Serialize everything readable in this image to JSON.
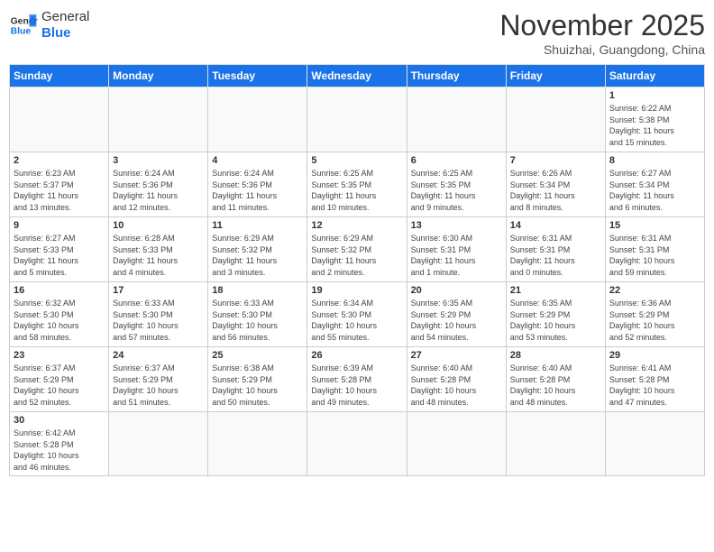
{
  "logo": {
    "line1": "General",
    "line2": "Blue"
  },
  "title": "November 2025",
  "location": "Shuizhai, Guangdong, China",
  "days_of_week": [
    "Sunday",
    "Monday",
    "Tuesday",
    "Wednesday",
    "Thursday",
    "Friday",
    "Saturday"
  ],
  "weeks": [
    [
      {
        "day": "",
        "info": ""
      },
      {
        "day": "",
        "info": ""
      },
      {
        "day": "",
        "info": ""
      },
      {
        "day": "",
        "info": ""
      },
      {
        "day": "",
        "info": ""
      },
      {
        "day": "",
        "info": ""
      },
      {
        "day": "1",
        "info": "Sunrise: 6:22 AM\nSunset: 5:38 PM\nDaylight: 11 hours\nand 15 minutes."
      }
    ],
    [
      {
        "day": "2",
        "info": "Sunrise: 6:23 AM\nSunset: 5:37 PM\nDaylight: 11 hours\nand 13 minutes."
      },
      {
        "day": "3",
        "info": "Sunrise: 6:24 AM\nSunset: 5:36 PM\nDaylight: 11 hours\nand 12 minutes."
      },
      {
        "day": "4",
        "info": "Sunrise: 6:24 AM\nSunset: 5:36 PM\nDaylight: 11 hours\nand 11 minutes."
      },
      {
        "day": "5",
        "info": "Sunrise: 6:25 AM\nSunset: 5:35 PM\nDaylight: 11 hours\nand 10 minutes."
      },
      {
        "day": "6",
        "info": "Sunrise: 6:25 AM\nSunset: 5:35 PM\nDaylight: 11 hours\nand 9 minutes."
      },
      {
        "day": "7",
        "info": "Sunrise: 6:26 AM\nSunset: 5:34 PM\nDaylight: 11 hours\nand 8 minutes."
      },
      {
        "day": "8",
        "info": "Sunrise: 6:27 AM\nSunset: 5:34 PM\nDaylight: 11 hours\nand 6 minutes."
      }
    ],
    [
      {
        "day": "9",
        "info": "Sunrise: 6:27 AM\nSunset: 5:33 PM\nDaylight: 11 hours\nand 5 minutes."
      },
      {
        "day": "10",
        "info": "Sunrise: 6:28 AM\nSunset: 5:33 PM\nDaylight: 11 hours\nand 4 minutes."
      },
      {
        "day": "11",
        "info": "Sunrise: 6:29 AM\nSunset: 5:32 PM\nDaylight: 11 hours\nand 3 minutes."
      },
      {
        "day": "12",
        "info": "Sunrise: 6:29 AM\nSunset: 5:32 PM\nDaylight: 11 hours\nand 2 minutes."
      },
      {
        "day": "13",
        "info": "Sunrise: 6:30 AM\nSunset: 5:31 PM\nDaylight: 11 hours\nand 1 minute."
      },
      {
        "day": "14",
        "info": "Sunrise: 6:31 AM\nSunset: 5:31 PM\nDaylight: 11 hours\nand 0 minutes."
      },
      {
        "day": "15",
        "info": "Sunrise: 6:31 AM\nSunset: 5:31 PM\nDaylight: 10 hours\nand 59 minutes."
      }
    ],
    [
      {
        "day": "16",
        "info": "Sunrise: 6:32 AM\nSunset: 5:30 PM\nDaylight: 10 hours\nand 58 minutes."
      },
      {
        "day": "17",
        "info": "Sunrise: 6:33 AM\nSunset: 5:30 PM\nDaylight: 10 hours\nand 57 minutes."
      },
      {
        "day": "18",
        "info": "Sunrise: 6:33 AM\nSunset: 5:30 PM\nDaylight: 10 hours\nand 56 minutes."
      },
      {
        "day": "19",
        "info": "Sunrise: 6:34 AM\nSunset: 5:30 PM\nDaylight: 10 hours\nand 55 minutes."
      },
      {
        "day": "20",
        "info": "Sunrise: 6:35 AM\nSunset: 5:29 PM\nDaylight: 10 hours\nand 54 minutes."
      },
      {
        "day": "21",
        "info": "Sunrise: 6:35 AM\nSunset: 5:29 PM\nDaylight: 10 hours\nand 53 minutes."
      },
      {
        "day": "22",
        "info": "Sunrise: 6:36 AM\nSunset: 5:29 PM\nDaylight: 10 hours\nand 52 minutes."
      }
    ],
    [
      {
        "day": "23",
        "info": "Sunrise: 6:37 AM\nSunset: 5:29 PM\nDaylight: 10 hours\nand 52 minutes."
      },
      {
        "day": "24",
        "info": "Sunrise: 6:37 AM\nSunset: 5:29 PM\nDaylight: 10 hours\nand 51 minutes."
      },
      {
        "day": "25",
        "info": "Sunrise: 6:38 AM\nSunset: 5:29 PM\nDaylight: 10 hours\nand 50 minutes."
      },
      {
        "day": "26",
        "info": "Sunrise: 6:39 AM\nSunset: 5:28 PM\nDaylight: 10 hours\nand 49 minutes."
      },
      {
        "day": "27",
        "info": "Sunrise: 6:40 AM\nSunset: 5:28 PM\nDaylight: 10 hours\nand 48 minutes."
      },
      {
        "day": "28",
        "info": "Sunrise: 6:40 AM\nSunset: 5:28 PM\nDaylight: 10 hours\nand 48 minutes."
      },
      {
        "day": "29",
        "info": "Sunrise: 6:41 AM\nSunset: 5:28 PM\nDaylight: 10 hours\nand 47 minutes."
      }
    ],
    [
      {
        "day": "30",
        "info": "Sunrise: 6:42 AM\nSunset: 5:28 PM\nDaylight: 10 hours\nand 46 minutes."
      },
      {
        "day": "",
        "info": ""
      },
      {
        "day": "",
        "info": ""
      },
      {
        "day": "",
        "info": ""
      },
      {
        "day": "",
        "info": ""
      },
      {
        "day": "",
        "info": ""
      },
      {
        "day": "",
        "info": ""
      }
    ]
  ]
}
